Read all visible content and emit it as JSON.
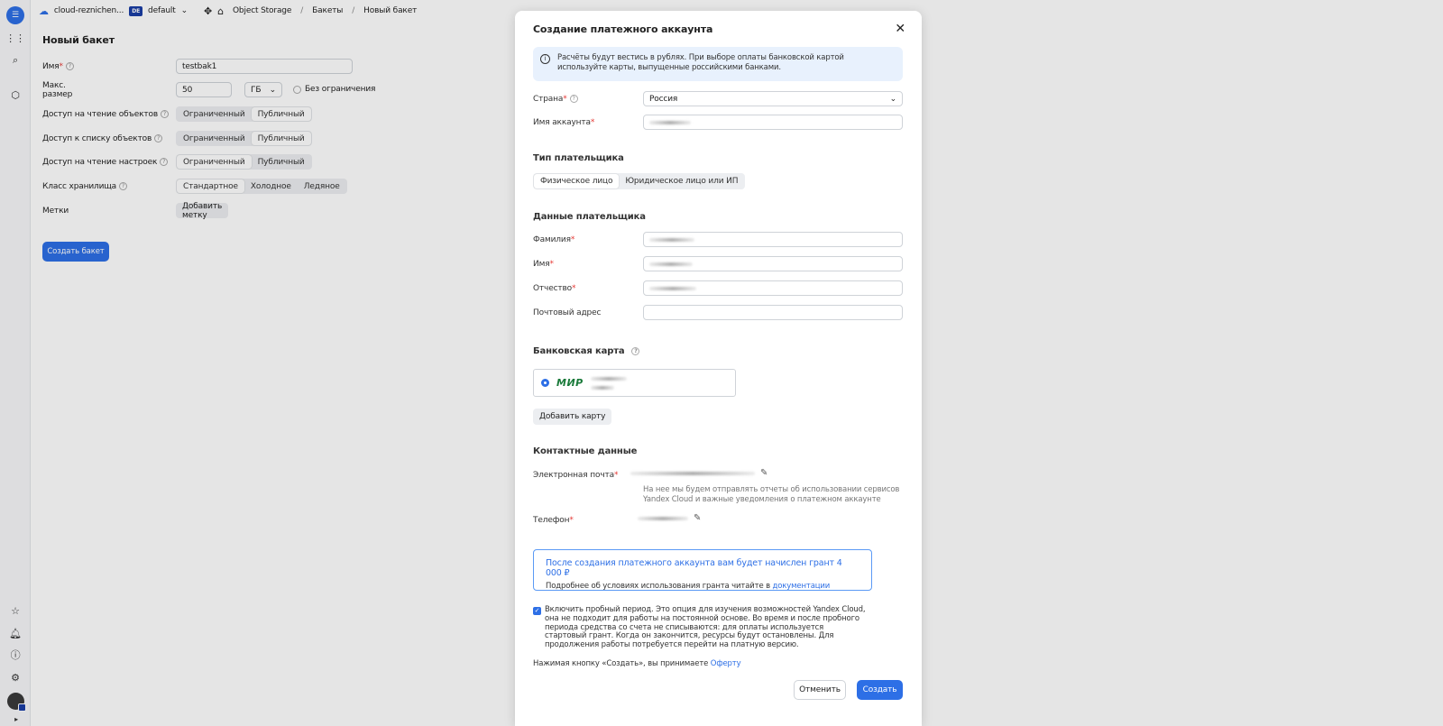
{
  "topbar": {
    "cloud_name": "cloud-reznichen...",
    "folder_badge": "DE",
    "folder_name": "default",
    "service": "Object Storage",
    "breadcrumb_1": "Бакеты",
    "breadcrumb_2": "Новый бакет"
  },
  "form": {
    "title": "Новый бакет",
    "name_label": "Имя",
    "name_value": "testbak1",
    "max_size_label": "Макс. размер",
    "max_size_value": "50",
    "max_size_unit": "ГБ",
    "no_limit_label": "Без ограничения",
    "read_objects_label": "Доступ на чтение объектов",
    "list_objects_label": "Доступ к списку объектов",
    "read_settings_label": "Доступ на чтение настроек",
    "access_limited": "Ограниченный",
    "access_public": "Публичный",
    "storage_class_label": "Класс хранилища",
    "class_standard": "Стандартное",
    "class_cold": "Холодное",
    "class_ice": "Ледяное",
    "tags_label": "Метки",
    "add_tag_button": "Добавить метку",
    "create_bucket_button": "Создать бакет"
  },
  "modal": {
    "title": "Создание платежного аккаунта",
    "info_text": "Расчёты будут вестись в рублях. При выборе оплаты банковской картой используйте карты, выпущенные российскими банками.",
    "country_label": "Страна",
    "country_value": "Россия",
    "account_name_label": "Имя аккаунта",
    "payer_type_title": "Тип плательщика",
    "payer_individual": "Физическое лицо",
    "payer_legal": "Юридическое лицо или ИП",
    "payer_data_title": "Данные плательщика",
    "surname_label": "Фамилия",
    "first_name_label": "Имя",
    "patronymic_label": "Отчество",
    "postal_label": "Почтовый адрес",
    "bank_card_title": "Банковская карта",
    "card_brand": "МИР",
    "add_card_button": "Добавить карту",
    "contacts_title": "Контактные данные",
    "email_label": "Электронная почта",
    "email_hint": "На нее мы будем отправлять отчеты об использовании сервисов Yandex Cloud и важные уведомления о платежном аккаунте",
    "phone_label": "Телефон",
    "grant_title": "После создания платежного аккаунта вам будет начислен грант 4 000 ₽",
    "grant_text": "Подробнее об условиях использования гранта читайте в",
    "grant_link": "документации",
    "trial_text": "Включить пробный период. Это опция для изучения возможностей Yandex Cloud, она не подходит для работы на постоянной основе. Во время и после пробного периода средства со счета не списываются: для оплаты используется стартовый грант. Когда он закончится, ресурсы будут остановлены. Для продолжения работы потребуется перейти на платную версию.",
    "offer_text": "Нажимая кнопку «Создать», вы принимаете",
    "offer_link": "Оферту",
    "cancel_button": "Отменить",
    "create_button": "Создать"
  }
}
